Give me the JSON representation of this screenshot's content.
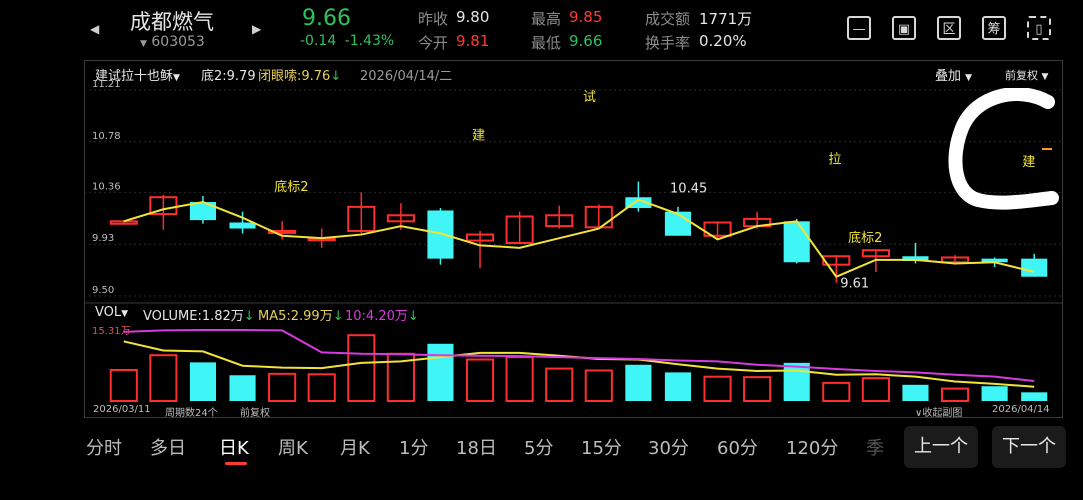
{
  "stock": {
    "name": "成都燃气",
    "code": "603053",
    "price": "9.66",
    "change": "-0.14",
    "change_pct": "-1.43%"
  },
  "quote": {
    "prev_close_label": "昨收",
    "prev_close": "9.80",
    "open_label": "今开",
    "open": "9.81",
    "high_label": "最高",
    "high": "9.85",
    "low_label": "最低",
    "low": "9.66",
    "volume_label": "成交额",
    "volume": "1771万",
    "turnover_label": "换手率",
    "turnover": "0.20%"
  },
  "toolbar_icons": [
    "minus-box-icon",
    "image-icon",
    "zone-icon",
    "chip-icon",
    "device-switch-icon"
  ],
  "toolbar_glyphs": {
    "zone": "区",
    "chip": "筹"
  },
  "chart": {
    "indicator_name": "建试拉十也稣",
    "indicator_b": "底2:9.79",
    "indicator_c": "闭眼嗦:9.76",
    "date_label": "2026/04/14/二",
    "overlay_label": "叠加",
    "adjust_label": "前复权",
    "vol_name": "VOL",
    "vol_value": "VOLUME:1.82万",
    "ma5": "MA5:2.99万",
    "ma10": "10:4.20万",
    "bottom_start": "2026/03/11",
    "bottom_period": "周期数24个",
    "bottom_adj": "前复权",
    "collapse": "收起副图",
    "bottom_end": "2026/04/14"
  },
  "chart_data": {
    "type": "candlestick",
    "y_ticks": [
      "11.21",
      "10.78",
      "10.36",
      "9.93",
      "9.50"
    ],
    "ylim": [
      9.5,
      11.21
    ],
    "vol_max_label": "15.31万",
    "vol_max": 15.31,
    "candles": [
      {
        "o": 10.1,
        "c": 10.12,
        "h": 10.12,
        "l": 10.1
      },
      {
        "o": 10.18,
        "c": 10.32,
        "h": 10.34,
        "l": 10.05
      },
      {
        "o": 10.28,
        "c": 10.13,
        "h": 10.33,
        "l": 10.1
      },
      {
        "o": 10.11,
        "c": 10.06,
        "h": 10.2,
        "l": 10.02
      },
      {
        "o": 10.04,
        "c": 10.04,
        "h": 10.12,
        "l": 9.97
      },
      {
        "o": 9.98,
        "c": 9.98,
        "h": 10.06,
        "l": 9.9
      },
      {
        "o": 10.04,
        "c": 10.24,
        "h": 10.36,
        "l": 10.02
      },
      {
        "o": 10.12,
        "c": 10.17,
        "h": 10.27,
        "l": 10.05
      },
      {
        "o": 10.21,
        "c": 9.81,
        "h": 10.23,
        "l": 9.76
      },
      {
        "o": 9.96,
        "c": 10.01,
        "h": 10.04,
        "l": 9.73
      },
      {
        "o": 9.94,
        "c": 10.16,
        "h": 10.2,
        "l": 9.93
      },
      {
        "o": 10.08,
        "c": 10.17,
        "h": 10.25,
        "l": 10.06
      },
      {
        "o": 10.07,
        "c": 10.24,
        "h": 10.26,
        "l": 10.07
      },
      {
        "o": 10.32,
        "c": 10.23,
        "h": 10.45,
        "l": 10.2
      },
      {
        "o": 10.2,
        "c": 10.0,
        "h": 10.24,
        "l": 10.0
      },
      {
        "o": 10.0,
        "c": 10.11,
        "h": 10.12,
        "l": 9.98
      },
      {
        "o": 10.08,
        "c": 10.14,
        "h": 10.2,
        "l": 10.06
      },
      {
        "o": 10.12,
        "c": 9.78,
        "h": 10.14,
        "l": 9.77
      },
      {
        "o": 9.76,
        "c": 9.83,
        "h": 9.84,
        "l": 9.61
      },
      {
        "o": 9.83,
        "c": 9.88,
        "h": 9.88,
        "l": 9.7
      },
      {
        "o": 9.83,
        "c": 9.79,
        "h": 9.94,
        "l": 9.77
      },
      {
        "o": 9.78,
        "c": 9.82,
        "h": 9.84,
        "l": 9.76
      },
      {
        "o": 9.81,
        "c": 9.78,
        "h": 9.82,
        "l": 9.74
      },
      {
        "o": 9.81,
        "c": 9.66,
        "h": 9.85,
        "l": 9.66
      }
    ],
    "line": [
      10.12,
      10.22,
      10.28,
      10.15,
      10.0,
      9.98,
      10.01,
      10.08,
      10.02,
      9.92,
      9.9,
      9.98,
      10.06,
      10.3,
      10.18,
      9.97,
      10.08,
      10.12,
      9.66,
      9.8,
      9.8,
      9.77,
      9.78,
      9.7
    ],
    "volume": [
      6.5,
      9.6,
      8.1,
      5.4,
      5.7,
      5.6,
      13.8,
      9.9,
      12.0,
      8.7,
      9.2,
      6.8,
      6.4,
      7.6,
      6.0,
      5.1,
      5.0,
      8.0,
      3.8,
      4.8,
      3.4,
      2.6,
      3.1,
      1.82
    ],
    "ma5": [
      12.5,
      10.6,
      10.4,
      7.4,
      7.0,
      6.9,
      8.0,
      8.3,
      9.2,
      10.1,
      10.1,
      9.5,
      8.8,
      8.7,
      7.7,
      6.8,
      6.3,
      6.4,
      5.5,
      5.6,
      5.1,
      4.1,
      3.6,
      2.99
    ],
    "ma10": [
      14.5,
      14.8,
      14.9,
      14.9,
      14.8,
      10.2,
      9.9,
      9.8,
      9.6,
      9.5,
      9.4,
      9.2,
      9.0,
      8.8,
      8.5,
      8.3,
      7.6,
      7.2,
      6.7,
      6.3,
      6.0,
      5.5,
      5.1,
      4.2
    ],
    "annotations": [
      {
        "text": "试",
        "i": 12.1,
        "y": 11.12
      },
      {
        "text": "建",
        "i": 9.3,
        "y": 10.8
      },
      {
        "text": "底标2",
        "i": 4.3,
        "y": 10.37
      },
      {
        "text": "10.45",
        "i": 14.3,
        "y": 10.36
      },
      {
        "text": "拉",
        "i": 18.3,
        "y": 10.6
      },
      {
        "text": "底标2",
        "i": 18.8,
        "y": 9.95
      },
      {
        "text": "9.61",
        "i": 18.6,
        "y": 9.57
      },
      {
        "text": "建",
        "i": 23.2,
        "y": 10.58
      }
    ]
  },
  "periods": [
    "分时",
    "多日",
    "日K",
    "周K",
    "月K",
    "1分",
    "18日",
    "5分",
    "15分",
    "30分",
    "60分",
    "120分",
    "季"
  ],
  "active_period": 2,
  "nav": {
    "prev": "上一个",
    "next": "下一个"
  }
}
